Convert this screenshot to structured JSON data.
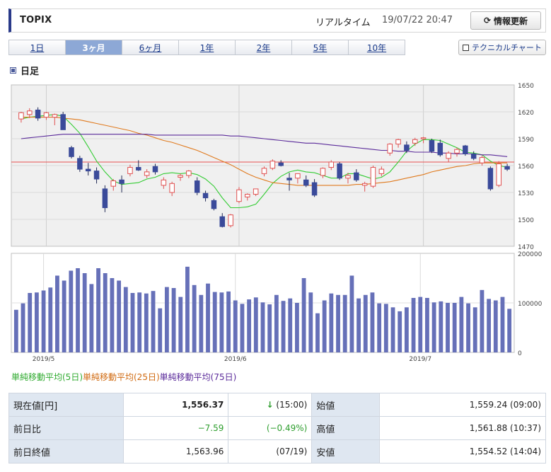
{
  "header": {
    "title": "TOPIX",
    "realtime_label": "リアルタイム",
    "timestamp": "19/07/22 20:47",
    "refresh_label": "情報更新"
  },
  "tabs": [
    {
      "label": "1日",
      "active": false
    },
    {
      "label": "3ヶ月",
      "active": true
    },
    {
      "label": "6ヶ月",
      "active": false
    },
    {
      "label": "1年",
      "active": false
    },
    {
      "label": "2年",
      "active": false
    },
    {
      "label": "5年",
      "active": false
    },
    {
      "label": "10年",
      "active": false
    }
  ],
  "tech_chart_label": "テクニカルチャート",
  "section_title": "日足",
  "legend": {
    "ma5": "単純移動平均(5日)",
    "ma25": "単純移動平均(25日)",
    "ma75": "単純移動平均(75日)"
  },
  "colors": {
    "up_candle": "#e05050",
    "down_candle": "#3a4a9a",
    "ma5": "#33cc33",
    "ma25": "#e07a1e",
    "ma75": "#5a2a9a",
    "volume": "#6670b8",
    "ref_line": "#e85050"
  },
  "chart_data": {
    "type": "candlestick",
    "price_axis": {
      "ylim": [
        1470,
        1650
      ],
      "ticks": [
        1470,
        1500,
        1530,
        1560,
        1590,
        1620,
        1650
      ]
    },
    "volume_axis": {
      "ylim": [
        0,
        200000
      ],
      "ticks": [
        "0",
        "100000",
        "200000"
      ]
    },
    "x_labels": [
      "2019/5",
      "2019/6",
      "2019/7"
    ],
    "x_label_index": [
      3,
      26,
      48
    ],
    "reference_line": 1563.96,
    "candles": [
      {
        "o": 1612,
        "h": 1620,
        "l": 1608,
        "c": 1619
      },
      {
        "o": 1617,
        "h": 1624,
        "l": 1613,
        "c": 1621
      },
      {
        "o": 1622,
        "h": 1625,
        "l": 1610,
        "c": 1613
      },
      {
        "o": 1614,
        "h": 1620,
        "l": 1611,
        "c": 1619
      },
      {
        "o": 1614,
        "h": 1618,
        "l": 1605,
        "c": 1617
      },
      {
        "o": 1617,
        "h": 1620,
        "l": 1604,
        "c": 1600
      },
      {
        "o": 1580,
        "h": 1582,
        "l": 1568,
        "c": 1570
      },
      {
        "o": 1568,
        "h": 1571,
        "l": 1553,
        "c": 1556
      },
      {
        "o": 1556,
        "h": 1563,
        "l": 1549,
        "c": 1554
      },
      {
        "o": 1554,
        "h": 1558,
        "l": 1540,
        "c": 1545
      },
      {
        "o": 1534,
        "h": 1538,
        "l": 1508,
        "c": 1513
      },
      {
        "o": 1537,
        "h": 1545,
        "l": 1532,
        "c": 1543
      },
      {
        "o": 1544,
        "h": 1549,
        "l": 1530,
        "c": 1540
      },
      {
        "o": 1551,
        "h": 1561,
        "l": 1548,
        "c": 1558
      },
      {
        "o": 1558,
        "h": 1566,
        "l": 1554,
        "c": 1555
      },
      {
        "o": 1549,
        "h": 1556,
        "l": 1546,
        "c": 1553
      },
      {
        "o": 1559,
        "h": 1562,
        "l": 1550,
        "c": 1553
      },
      {
        "o": 1538,
        "h": 1547,
        "l": 1534,
        "c": 1544
      },
      {
        "o": 1530,
        "h": 1542,
        "l": 1526,
        "c": 1540
      },
      {
        "o": 1547,
        "h": 1551,
        "l": 1543,
        "c": 1549
      },
      {
        "o": 1549,
        "h": 1555,
        "l": 1546,
        "c": 1554
      },
      {
        "o": 1543,
        "h": 1547,
        "l": 1527,
        "c": 1530
      },
      {
        "o": 1529,
        "h": 1532,
        "l": 1520,
        "c": 1524
      },
      {
        "o": 1521,
        "h": 1523,
        "l": 1510,
        "c": 1512
      },
      {
        "o": 1503,
        "h": 1507,
        "l": 1491,
        "c": 1492
      },
      {
        "o": 1493,
        "h": 1506,
        "l": 1491,
        "c": 1505
      },
      {
        "o": 1520,
        "h": 1536,
        "l": 1518,
        "c": 1533
      },
      {
        "o": 1525,
        "h": 1529,
        "l": 1521,
        "c": 1528
      },
      {
        "o": 1528,
        "h": 1534,
        "l": 1526,
        "c": 1534
      },
      {
        "o": 1551,
        "h": 1559,
        "l": 1548,
        "c": 1557
      },
      {
        "o": 1557,
        "h": 1567,
        "l": 1555,
        "c": 1565
      },
      {
        "o": 1563,
        "h": 1566,
        "l": 1559,
        "c": 1560
      },
      {
        "o": 1546,
        "h": 1552,
        "l": 1532,
        "c": 1544
      },
      {
        "o": 1546,
        "h": 1551,
        "l": 1540,
        "c": 1551
      },
      {
        "o": 1544,
        "h": 1549,
        "l": 1536,
        "c": 1538
      },
      {
        "o": 1541,
        "h": 1545,
        "l": 1525,
        "c": 1527
      },
      {
        "o": 1549,
        "h": 1558,
        "l": 1546,
        "c": 1557
      },
      {
        "o": 1558,
        "h": 1566,
        "l": 1555,
        "c": 1564
      },
      {
        "o": 1562,
        "h": 1564,
        "l": 1544,
        "c": 1546
      },
      {
        "o": 1546,
        "h": 1552,
        "l": 1540,
        "c": 1549
      },
      {
        "o": 1552,
        "h": 1556,
        "l": 1542,
        "c": 1544
      },
      {
        "o": 1538,
        "h": 1542,
        "l": 1531,
        "c": 1540
      },
      {
        "o": 1537,
        "h": 1560,
        "l": 1535,
        "c": 1558
      },
      {
        "o": 1551,
        "h": 1559,
        "l": 1548,
        "c": 1556
      },
      {
        "o": 1574,
        "h": 1585,
        "l": 1571,
        "c": 1584
      },
      {
        "o": 1584,
        "h": 1590,
        "l": 1580,
        "c": 1589
      },
      {
        "o": 1583,
        "h": 1587,
        "l": 1574,
        "c": 1577
      },
      {
        "o": 1585,
        "h": 1591,
        "l": 1582,
        "c": 1589
      },
      {
        "o": 1590,
        "h": 1592,
        "l": 1585,
        "c": 1591
      },
      {
        "o": 1588,
        "h": 1590,
        "l": 1574,
        "c": 1576
      },
      {
        "o": 1585,
        "h": 1589,
        "l": 1570,
        "c": 1572
      },
      {
        "o": 1568,
        "h": 1576,
        "l": 1564,
        "c": 1574
      },
      {
        "o": 1574,
        "h": 1580,
        "l": 1570,
        "c": 1578
      },
      {
        "o": 1582,
        "h": 1583,
        "l": 1571,
        "c": 1573
      },
      {
        "o": 1573,
        "h": 1576,
        "l": 1566,
        "c": 1568
      },
      {
        "o": 1563,
        "h": 1571,
        "l": 1560,
        "c": 1569
      },
      {
        "o": 1557,
        "h": 1559,
        "l": 1532,
        "c": 1534
      },
      {
        "o": 1538,
        "h": 1565,
        "l": 1536,
        "c": 1562
      },
      {
        "o": 1559,
        "h": 1562,
        "l": 1554,
        "c": 1556
      }
    ],
    "series": [
      {
        "name": "単純移動平均(5日)",
        "values": [
          1612,
          1614,
          1615,
          1616,
          1617,
          1615,
          1606,
          1596,
          1581,
          1565,
          1553,
          1543,
          1539,
          1540,
          1541,
          1545,
          1547,
          1551,
          1552,
          1551,
          1552,
          1550,
          1545,
          1537,
          1524,
          1513,
          1513,
          1514,
          1517,
          1528,
          1540,
          1548,
          1553,
          1555,
          1553,
          1552,
          1549,
          1546,
          1546,
          1551,
          1551,
          1548,
          1545,
          1547,
          1553,
          1564,
          1576,
          1584,
          1589,
          1589,
          1588,
          1584,
          1580,
          1575,
          1574,
          1572,
          1565,
          1560,
          1558
        ]
      },
      {
        "name": "単純移動平均(25日)",
        "values": [
          1614,
          1614,
          1614,
          1614,
          1614,
          1613,
          1612,
          1611,
          1609,
          1607,
          1605,
          1603,
          1601,
          1599,
          1596,
          1594,
          1591,
          1588,
          1586,
          1583,
          1580,
          1577,
          1573,
          1569,
          1565,
          1561,
          1556,
          1551,
          1547,
          1544,
          1541,
          1540,
          1539,
          1538,
          1538,
          1538,
          1538,
          1538,
          1538,
          1538,
          1539,
          1539,
          1540,
          1541,
          1542,
          1544,
          1546,
          1548,
          1550,
          1553,
          1555,
          1557,
          1559,
          1560,
          1562,
          1563,
          1563,
          1563,
          1563
        ]
      },
      {
        "name": "単純移動平均(75日)",
        "values": [
          1590,
          1591,
          1592,
          1593,
          1594,
          1595,
          1595,
          1595,
          1595,
          1595,
          1595,
          1595,
          1595,
          1595,
          1595,
          1595,
          1594,
          1594,
          1594,
          1594,
          1594,
          1594,
          1594,
          1594,
          1594,
          1593,
          1593,
          1592,
          1591,
          1590,
          1589,
          1588,
          1587,
          1586,
          1585,
          1585,
          1584,
          1583,
          1582,
          1581,
          1580,
          1579,
          1578,
          1577,
          1577,
          1576,
          1576,
          1575,
          1575,
          1575,
          1574,
          1574,
          1573,
          1573,
          1573,
          1572,
          1572,
          1571,
          1570
        ]
      }
    ],
    "volumes": [
      86000,
      99000,
      120000,
      121000,
      125000,
      131000,
      155000,
      145000,
      165000,
      170000,
      160000,
      138000,
      170000,
      160000,
      150000,
      145000,
      132000,
      120000,
      121000,
      119000,
      124000,
      89000,
      132000,
      130000,
      112000,
      173000,
      136000,
      116000,
      139000,
      122000,
      121000,
      123000,
      105000,
      98000,
      107000,
      111000,
      101000,
      97000,
      116000,
      104000,
      109000,
      100000,
      150000,
      121000,
      79000,
      105000,
      119000,
      116000,
      116000,
      155000,
      109000,
      116000,
      121000,
      99000,
      98000,
      91000,
      83000,
      91000,
      110000,
      112000,
      110000,
      101000,
      103000,
      100000,
      100000,
      112000,
      99000,
      91000,
      126000,
      108000,
      105000,
      112000,
      88000
    ]
  },
  "quote": {
    "current_label": "現在値[円]",
    "current_value": "1,556.37",
    "current_arrow": "↓",
    "current_time": "(15:00)",
    "open_label": "始値",
    "open_value": "1,559.24 (09:00)",
    "change_label": "前日比",
    "change_value": "−7.59",
    "change_pct": "(−0.49%)",
    "high_label": "高値",
    "high_value": "1,561.88 (10:37)",
    "prev_close_label": "前日終値",
    "prev_close_value": "1,563.96",
    "prev_close_date": "(07/19)",
    "low_label": "安値",
    "low_value": "1,554.52 (14:04)"
  }
}
